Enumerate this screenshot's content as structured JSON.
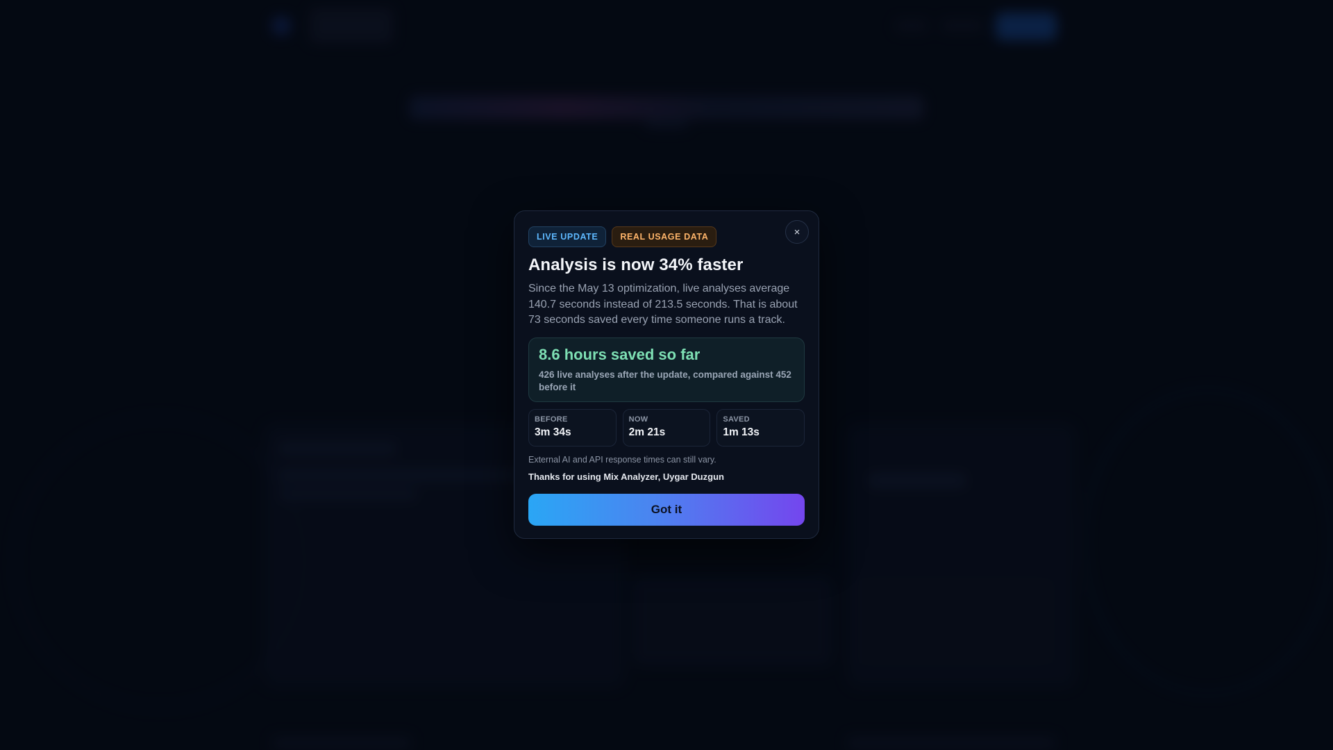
{
  "modal": {
    "badges": {
      "live": "LIVE UPDATE",
      "real": "REAL USAGE DATA"
    },
    "close_icon": "×",
    "title": "Analysis is now 34% faster",
    "description": "Since the May 13 optimization, live analyses average 140.7 seconds instead of 213.5 seconds. That is about 73 seconds saved every time someone runs a track.",
    "highlight": {
      "title": "8.6 hours saved so far",
      "subtitle": "426 live analyses after the update, compared against 452 before it"
    },
    "stats": [
      {
        "label": "BEFORE",
        "value": "3m 34s"
      },
      {
        "label": "NOW",
        "value": "2m 21s"
      },
      {
        "label": "SAVED",
        "value": "1m 13s"
      }
    ],
    "note": "External AI and API response times can still vary.",
    "thanks": "Thanks for using Mix Analyzer, Uygar Duzgun",
    "button_label": "Got it"
  },
  "colors": {
    "live_badge": "#5eb9ff",
    "real_badge": "#ffb56a",
    "highlight": "#7ee0b4",
    "button_start": "#2aa6f5",
    "button_end": "#7446ee"
  },
  "icons": {
    "close": "close-icon"
  }
}
